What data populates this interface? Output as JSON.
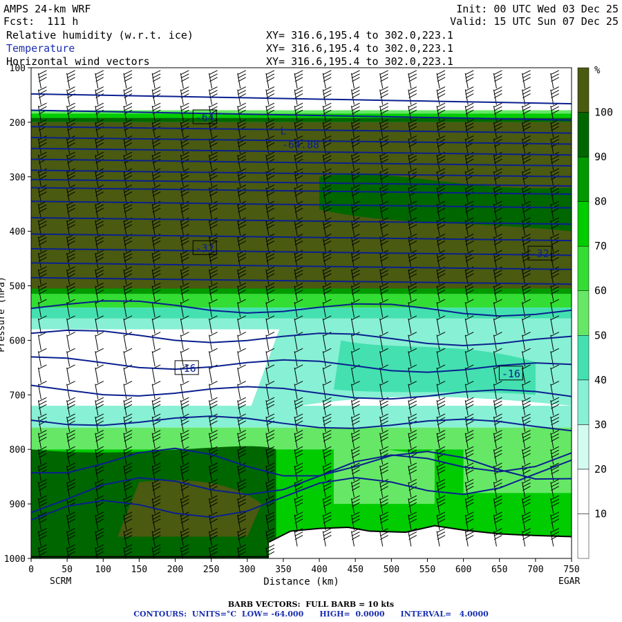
{
  "header": {
    "model": "AMPS 24-km WRF",
    "forecast": "Fcst:  111 h",
    "init": "Init: 00 UTC Wed 03 Dec 25",
    "valid": "Valid: 15 UTC Sun 07 Dec 25",
    "fields": [
      {
        "name": "Relative humidity (w.r.t. ice)",
        "xy": "XY= 316.6,195.4 to 302.0,223.1",
        "color": "#000000"
      },
      {
        "name": "Temperature",
        "xy": "XY= 316.6,195.4 to 302.0,223.1",
        "color": "#1a2fb0"
      },
      {
        "name": "Horizontal wind vectors",
        "xy": "XY= 316.6,195.4 to 302.0,223.1",
        "color": "#000000"
      }
    ]
  },
  "footer": {
    "barbs": "BARB VECTORS:  FULL BARB = 10 kts",
    "contours": "CONTOURS:  UNITS=°C  LOW= -64.000      HIGH=  0.0000      INTERVAL=   4.0000"
  },
  "chart_data": {
    "type": "heatmap",
    "title": "Relative humidity (w.r.t. ice), Temperature, Horizontal wind vectors",
    "xlabel": "Distance (km)",
    "ylabel": "Pressure (hPa)",
    "x_ticks": [
      0,
      50,
      100,
      150,
      200,
      250,
      300,
      350,
      400,
      450,
      500,
      550,
      600,
      650,
      700,
      750
    ],
    "y_ticks": [
      100,
      200,
      300,
      400,
      500,
      600,
      700,
      800,
      900,
      1000
    ],
    "xlim": [
      0,
      750
    ],
    "ylim": [
      1000,
      100
    ],
    "stations": {
      "left": "SCRM",
      "right": "EGAR"
    },
    "colorbar": {
      "unit": "%",
      "levels": [
        10,
        20,
        30,
        40,
        50,
        60,
        70,
        80,
        90,
        100
      ],
      "colors": [
        "#ffffff",
        "#ffffff",
        "#d4fbf0",
        "#88f0d4",
        "#44e0b0",
        "#66e866",
        "#33dd33",
        "#00cc00",
        "#009900",
        "#006600",
        "#4a5a10"
      ]
    },
    "temperature_contour_labels": [
      {
        "text": "-64",
        "x": 240,
        "p": 190
      },
      {
        "text": "-32",
        "x": 240,
        "p": 430
      },
      {
        "text": "-32",
        "x": 705,
        "p": 440
      },
      {
        "text": "-16",
        "x": 215,
        "p": 650
      },
      {
        "text": "-16",
        "x": 665,
        "p": 660
      }
    ],
    "low_marker": {
      "label": "L",
      "value": "-64.88",
      "x": 350,
      "p": 240
    },
    "humidity_field": [
      {
        "p_top": 100,
        "p_bottom": 180,
        "rh": "<10"
      },
      {
        "p_top": 180,
        "p_bottom": 510,
        "rh": ">100"
      },
      {
        "p_top": 510,
        "p_bottom": 560,
        "rh": "60-90"
      },
      {
        "p_top": 560,
        "p_bottom": 720,
        "rh": "10-40"
      },
      {
        "p_top": 720,
        "p_bottom": 1000,
        "rh": "50-100"
      }
    ]
  }
}
